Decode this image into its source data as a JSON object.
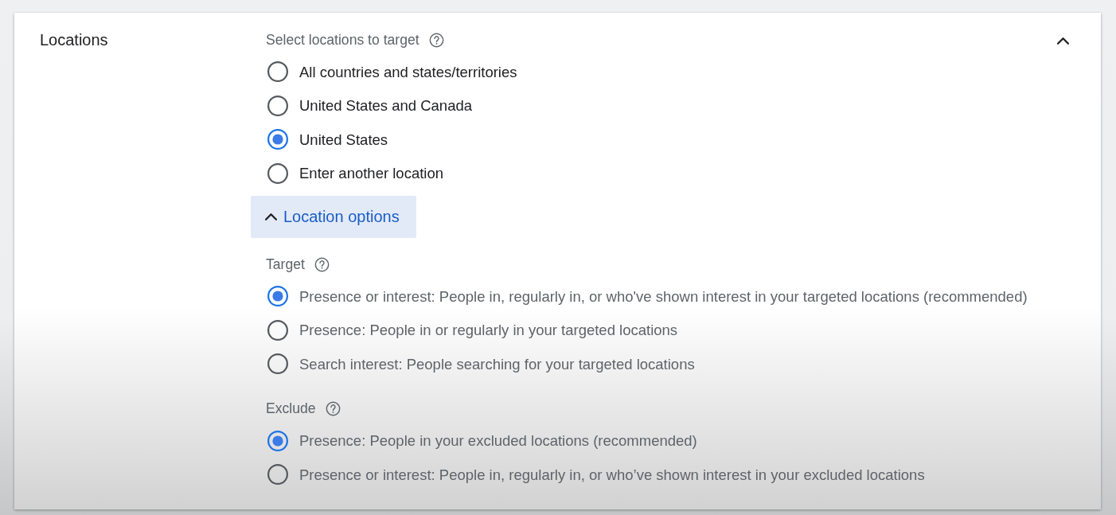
{
  "section": {
    "title": "Locations",
    "expanded": true
  },
  "select_locations": {
    "label": "Select locations to target",
    "options": [
      {
        "label": "All countries and states/territories",
        "selected": false
      },
      {
        "label": "United States and Canada",
        "selected": false
      },
      {
        "label": "United States",
        "selected": true
      },
      {
        "label": "Enter another location",
        "selected": false
      }
    ]
  },
  "location_options_button": {
    "label": "Location options",
    "expanded": true
  },
  "target": {
    "label": "Target",
    "options": [
      {
        "label": "Presence or interest: People in, regularly in, or who've shown interest in your targeted locations (recommended)",
        "selected": true
      },
      {
        "label": "Presence: People in or regularly in your targeted locations",
        "selected": false
      },
      {
        "label": "Search interest: People searching for your targeted locations",
        "selected": false
      }
    ]
  },
  "exclude": {
    "label": "Exclude",
    "options": [
      {
        "label": "Presence: People in your excluded locations (recommended)",
        "selected": true
      },
      {
        "label": "Presence or interest: People in, regularly in, or who’ve shown interest in your excluded locations",
        "selected": false
      }
    ]
  }
}
